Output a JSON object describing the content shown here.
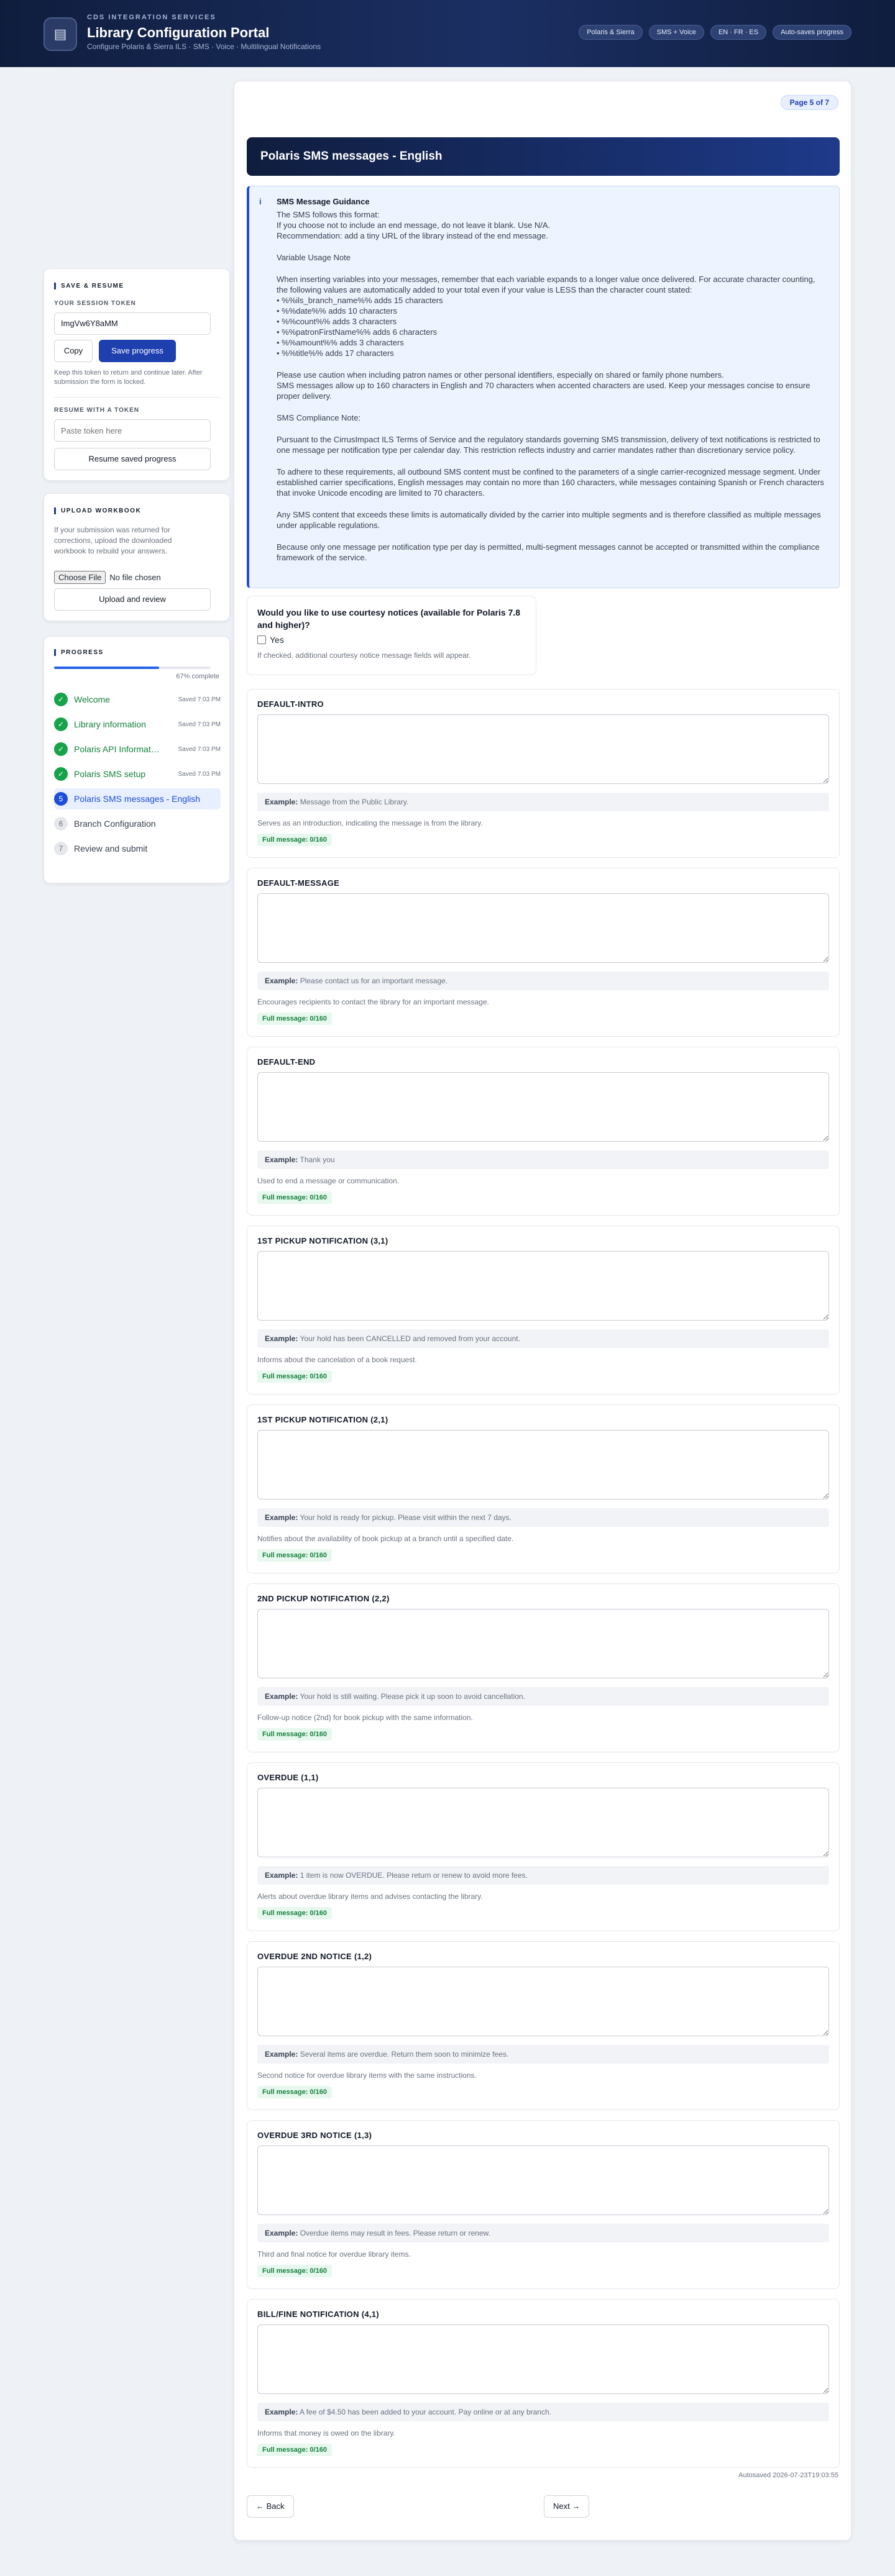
{
  "header": {
    "eyebrow": "CDS INTEGRATION SERVICES",
    "title": "Library Configuration Portal",
    "subtitle": "Configure Polaris & Sierra ILS · SMS · Voice · Multilingual Notifications",
    "chips": [
      "Polaris & Sierra",
      "SMS + Voice",
      "EN · FR · ES",
      "Auto-saves progress"
    ]
  },
  "save": {
    "heading": "SAVE & RESUME",
    "token_label": "YOUR SESSION TOKEN",
    "token_value": "ImgVw6Y8aMM",
    "copy": "Copy",
    "save_progress": "Save progress",
    "note": "Keep this token to return and continue later. After submission the form is locked.",
    "resume_label": "RESUME WITH A TOKEN",
    "resume_placeholder": "Paste token here",
    "resume_button": "Resume saved progress"
  },
  "upload": {
    "heading": "UPLOAD WORKBOOK",
    "note": "If your submission was returned for corrections, upload the downloaded workbook to rebuild your answers.",
    "choose": "Choose File",
    "no_file": "No file chosen",
    "button": "Upload and review"
  },
  "progress": {
    "heading": "PROGRESS",
    "percent_label": "67% complete",
    "fraction": 0.67,
    "items": [
      {
        "num": "✓",
        "name": "Welcome",
        "saved": "Saved 7:03 PM"
      },
      {
        "num": "✓",
        "name": "Library information",
        "saved": "Saved 7:03 PM"
      },
      {
        "num": "✓",
        "name": "Polaris API Information",
        "saved": "Saved 7:03 PM"
      },
      {
        "num": "✓",
        "name": "Polaris SMS setup",
        "saved": "Saved 7:03 PM"
      },
      {
        "num": "5",
        "name": "Polaris SMS messages - English",
        "saved": ""
      },
      {
        "num": "6",
        "name": "Branch Configuration",
        "saved": ""
      },
      {
        "num": "7",
        "name": "Review and submit",
        "saved": ""
      }
    ]
  },
  "main": {
    "page_badge": "Page 5 of 7",
    "section_title": "Polaris SMS messages - English",
    "guidance": {
      "title": "SMS Message Guidance",
      "p1": [
        "The SMS follows this format:",
        "If you choose not to include an end message, do not leave it blank. Use N/A.",
        "Recommendation: add a tiny URL of the library instead of the end message."
      ],
      "p2": "Variable Usage Note",
      "p3": "When inserting variables into your messages, remember that each variable expands to a longer value once delivered. For accurate character counting, the following values are automatically added to your total even if your value is LESS than the character count stated:",
      "vars": [
        "• %%ils_branch_name%% adds 15 characters",
        "• %%date%% adds 10 characters",
        "• %%count%% adds 3 characters",
        "• %%patronFirstName%% adds 6 characters",
        "• %%amount%% adds 3 characters",
        "• %%title%% adds 17 characters"
      ],
      "p4": [
        "Please use caution when including patron names or other personal identifiers, especially on shared or family phone numbers.",
        "SMS messages allow up to 160 characters in English and 70 characters when accented characters are used. Keep your messages concise to ensure proper delivery."
      ],
      "p5": "SMS Compliance Note:",
      "p6": "Pursuant to the CirrusImpact ILS Terms of Service and the regulatory standards governing SMS transmission, delivery of text notifications is restricted to one message per notification type per calendar day. This restriction reflects industry and carrier mandates rather than discretionary service policy.",
      "p7": "To adhere to these requirements, all outbound SMS content must be confined to the parameters of a single carrier-recognized message segment. Under established carrier specifications, English messages may contain no more than 160 characters, while messages containing Spanish or French characters that invoke Unicode encoding are limited to 70 characters.",
      "p8": "Any SMS content that exceeds these limits is automatically divided by the carrier into multiple segments and is therefore classified as multiple messages under applicable regulations.",
      "p9": "Because only one message per notification type per day is permitted, multi-segment messages cannot be accepted or transmitted within the compliance framework of the service."
    },
    "courtesy": {
      "question": "Would you like to use courtesy notices (available for Polaris 7.8 and higher)?",
      "yes": "Yes",
      "hint": "If checked, additional courtesy notice message fields will appear."
    },
    "example_label": "Example:",
    "messages": [
      {
        "title": "DEFAULT-INTRO",
        "example": "Message from the Public Library.",
        "desc": "Serves as an introduction, indicating the message is from the library.",
        "count": "Full message: 0/160"
      },
      {
        "title": "DEFAULT-MESSAGE",
        "example": "Please contact us for an important message.",
        "desc": "Encourages recipients to contact the library for an important message.",
        "count": "Full message: 0/160"
      },
      {
        "title": "DEFAULT-END",
        "example": "Thank you",
        "desc": "Used to end a message or communication.",
        "count": "Full message: 0/160"
      },
      {
        "title": "1ST PICKUP NOTIFICATION (3,1)",
        "example": "Your hold has been CANCELLED and removed from your account.",
        "desc": "Informs about the cancelation of a book request.",
        "count": "Full message: 0/160"
      },
      {
        "title": "1ST PICKUP NOTIFICATION (2,1)",
        "example": "Your hold is ready for pickup. Please visit within the next 7 days.",
        "desc": "Notifies about the availability of book pickup at a branch until a specified date.",
        "count": "Full message: 0/160"
      },
      {
        "title": "2ND PICKUP NOTIFICATION (2,2)",
        "example": "Your hold is still waiting. Please pick it up soon to avoid cancellation.",
        "desc": "Follow-up notice (2nd) for book pickup with the same information.",
        "count": "Full message: 0/160"
      },
      {
        "title": "OVERDUE (1,1)",
        "example": "1 item is now OVERDUE. Please return or renew to avoid more fees.",
        "desc": "Alerts about overdue library items and advises contacting the library.",
        "count": "Full message: 0/160"
      },
      {
        "title": "OVERDUE 2ND NOTICE (1,2)",
        "example": "Several items are overdue. Return them soon to minimize fees.",
        "desc": "Second notice for overdue library items with the same instructions.",
        "count": "Full message: 0/160"
      },
      {
        "title": "OVERDUE 3RD NOTICE (1,3)",
        "example": "Overdue items may result in fees. Please return or renew.",
        "desc": "Third and final notice for overdue library items.",
        "count": "Full message: 0/160"
      },
      {
        "title": "BILL/FINE NOTIFICATION (4,1)",
        "example": "A fee of $4.50 has been added to your account. Pay online or at any branch.",
        "desc": "Informs that money is owed on the library.",
        "count": "Full message: 0/160"
      }
    ],
    "autosaved": "Autosaved 2026-07-23T19:03:55",
    "back": "← Back",
    "next": "Next →"
  }
}
